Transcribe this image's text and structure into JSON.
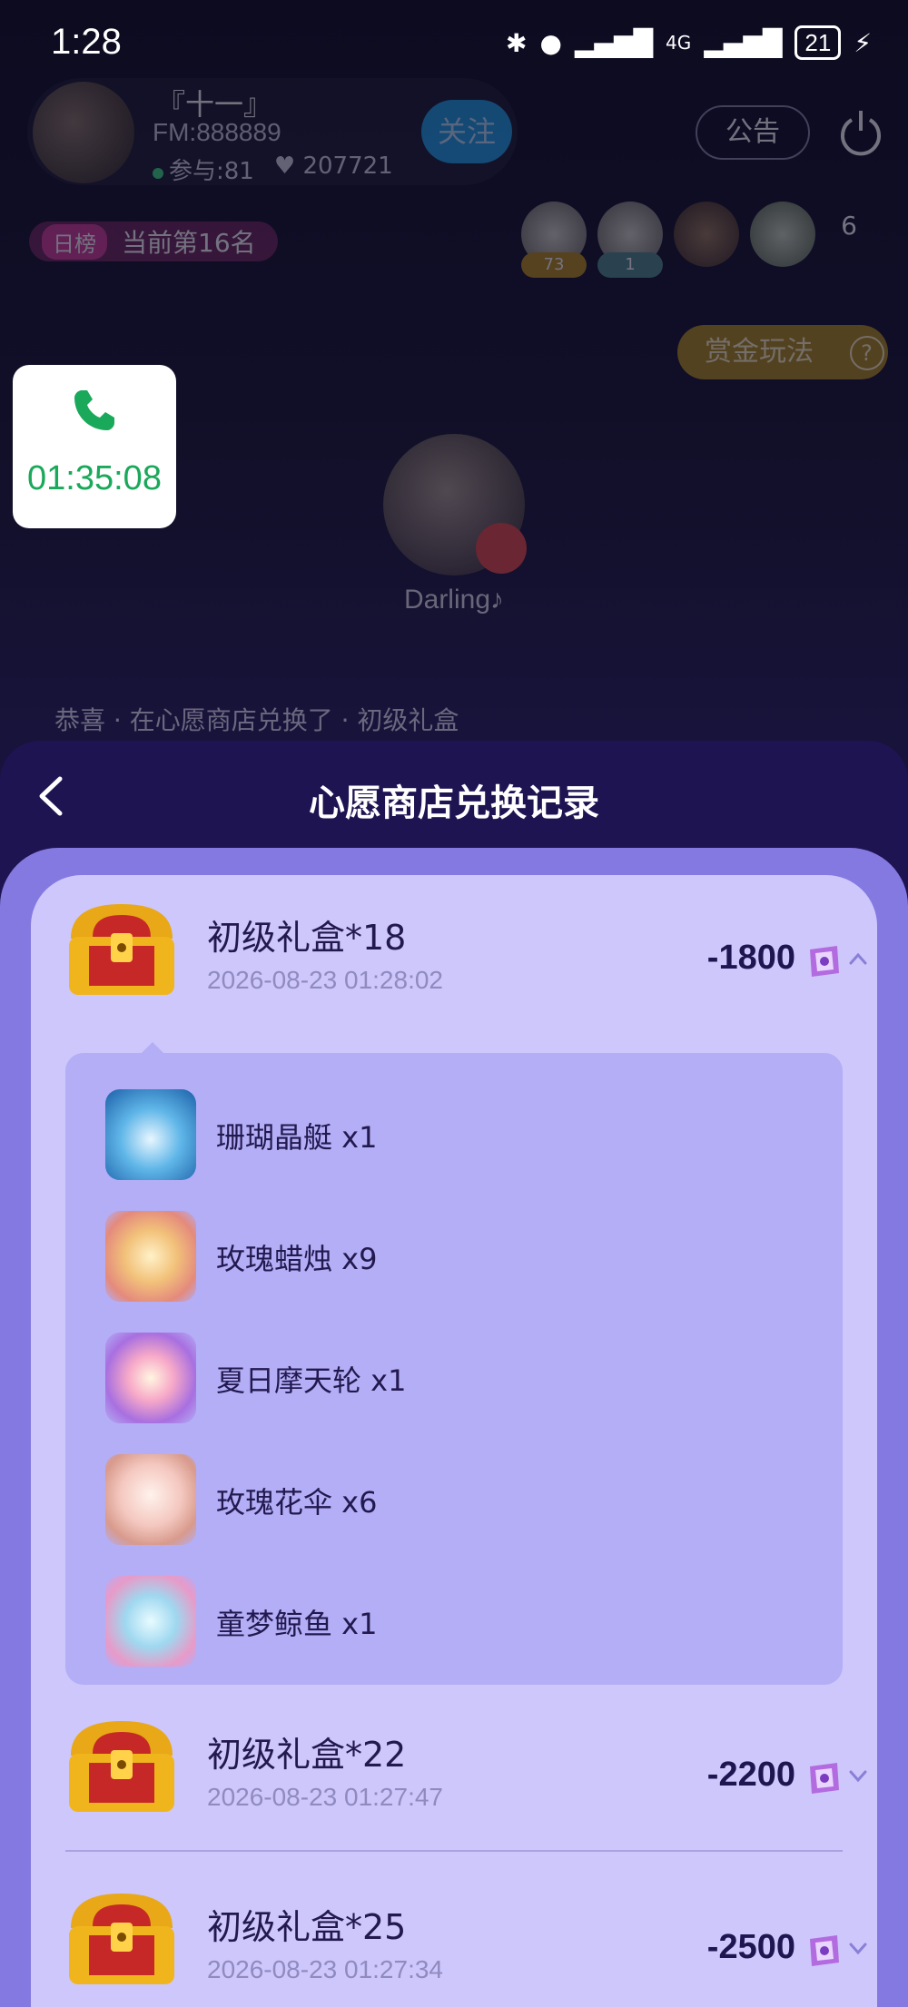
{
  "status_bar": {
    "time": "1:28",
    "battery": "21",
    "network": "4G"
  },
  "room": {
    "host_name": "『十一』",
    "fm_id": "FM:888889",
    "participants": "参与:81",
    "likes": "207721",
    "follow_label": "关注",
    "notice_label": "公告",
    "rank_tag": "日榜",
    "rank_text": "当前第16名",
    "fan_scores": [
      "73",
      "1"
    ],
    "fan_count": "6",
    "bounty_label": "赏金玩法",
    "bounty_help": "?",
    "mic_name": "Darling♪",
    "marquee": "恭喜 · 在心愿商店兑换了 · 初级礼盒"
  },
  "call_widget": {
    "duration": "01:35:08"
  },
  "sheet": {
    "title": "心愿商店兑换记录",
    "records": [
      {
        "title": "初级礼盒*18",
        "date": "2026-08-23 01:28:02",
        "amount": "-1800",
        "expanded": true,
        "items": [
          {
            "name": "珊瑚晶艇 x1"
          },
          {
            "name": "玫瑰蜡烛 x9"
          },
          {
            "name": "夏日摩天轮 x1"
          },
          {
            "name": "玫瑰花伞 x6"
          },
          {
            "name": "童梦鲸鱼 x1"
          }
        ]
      },
      {
        "title": "初级礼盒*22",
        "date": "2026-08-23 01:27:47",
        "amount": "-2200",
        "expanded": false
      },
      {
        "title": "初级礼盒*25",
        "date": "2026-08-23 01:27:34",
        "amount": "-2500",
        "expanded": false
      }
    ]
  },
  "colors": {
    "sheet_dark": "#1e1452",
    "sheet_mid": "#8479e0",
    "card": "#cdc7fb",
    "detail": "#b3aef6",
    "amount": "#1e1650",
    "call_green": "#1aa85a"
  }
}
